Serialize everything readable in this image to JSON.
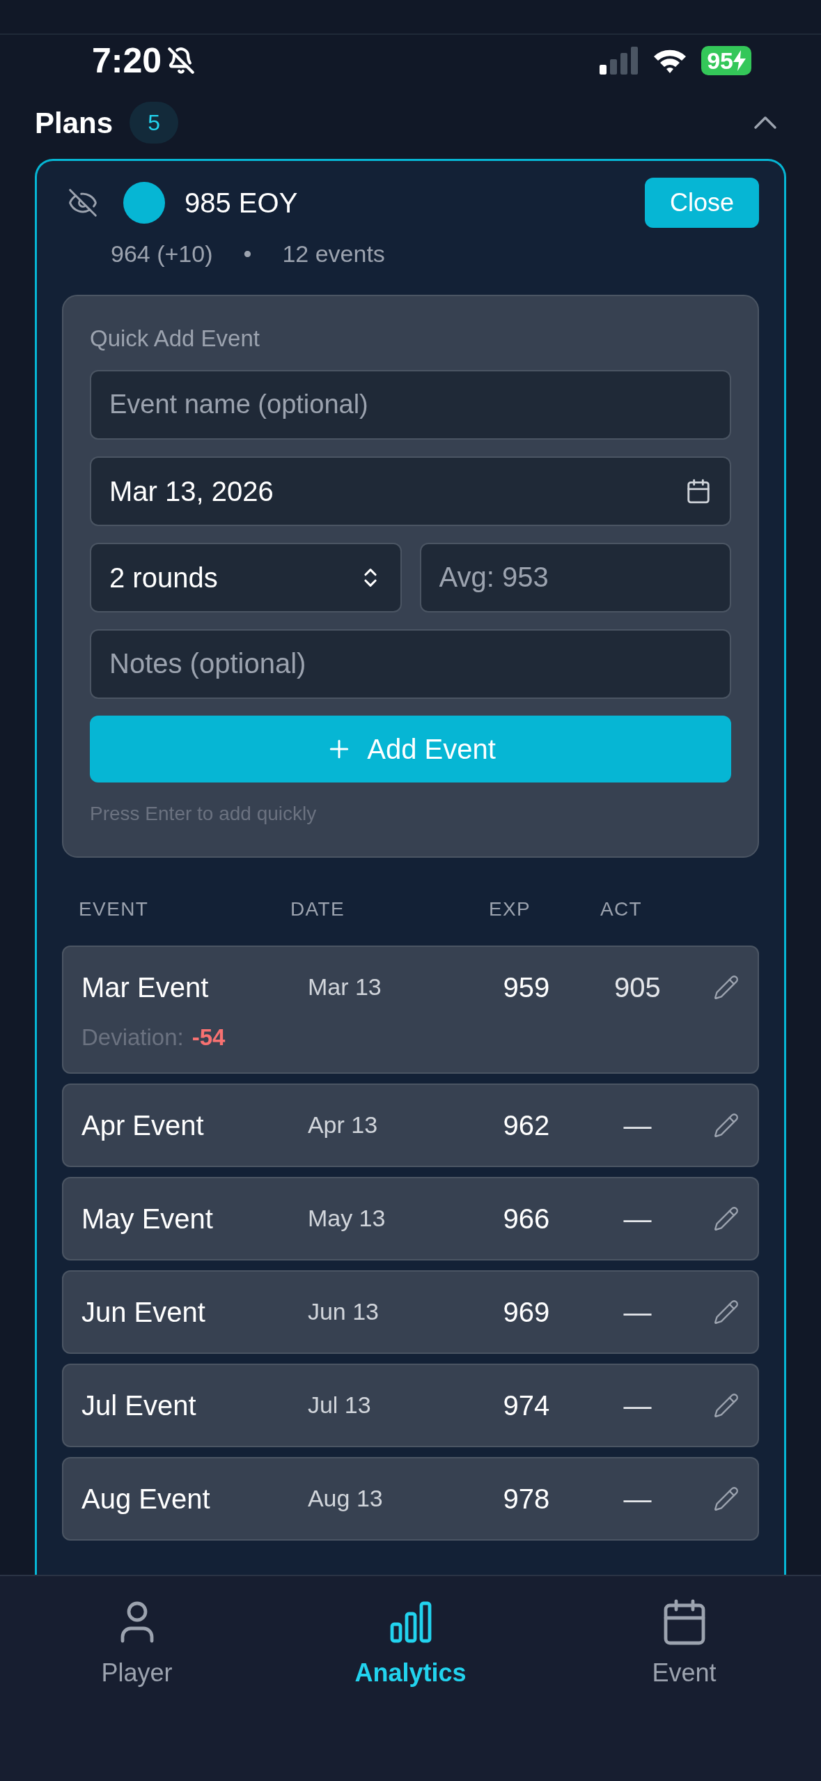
{
  "status_bar": {
    "time": "7:20",
    "battery": "95"
  },
  "plans": {
    "title": "Plans",
    "count": "5",
    "expanded": true
  },
  "plan": {
    "name": "985 EOY",
    "rating": "964 (+10)",
    "separator": "•",
    "events": "12 events",
    "close_label": "Close"
  },
  "quick_add": {
    "title": "Quick Add Event",
    "name_placeholder": "Event name (optional)",
    "date_value": "Mar 13, 2026",
    "rounds_value": "2 rounds",
    "avg_placeholder": "Avg: 953",
    "notes_placeholder": "Notes (optional)",
    "add_label": "Add Event",
    "hint": "Press Enter to add quickly"
  },
  "table": {
    "columns": [
      "EVENT",
      "DATE",
      "EXP",
      "ACT"
    ],
    "rows": [
      {
        "event": "Mar Event",
        "date": "Mar 13",
        "exp": "959",
        "act": "905",
        "deviation_label": "Deviation:",
        "deviation_value": "-54"
      },
      {
        "event": "Apr Event",
        "date": "Apr 13",
        "exp": "962",
        "act": "—"
      },
      {
        "event": "May Event",
        "date": "May 13",
        "exp": "966",
        "act": "—"
      },
      {
        "event": "Jun Event",
        "date": "Jun 13",
        "exp": "969",
        "act": "—"
      },
      {
        "event": "Jul Event",
        "date": "Jul 13",
        "exp": "974",
        "act": "—"
      },
      {
        "event": "Aug Event",
        "date": "Aug 13",
        "exp": "978",
        "act": "—"
      }
    ]
  },
  "nav": [
    {
      "label": "Player",
      "selected": false
    },
    {
      "label": "Analytics",
      "selected": true
    },
    {
      "label": "Event",
      "selected": false
    }
  ]
}
